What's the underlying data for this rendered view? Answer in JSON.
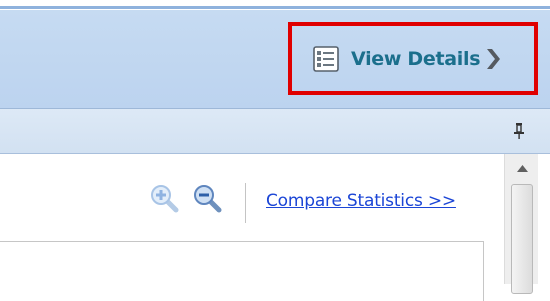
{
  "header": {
    "view_details_label": "View Details",
    "icons": {
      "details": "details-list-icon",
      "chevron": "chevron-right-icon"
    },
    "highlight_color": "#e00000"
  },
  "panel": {
    "icons": {
      "pin": "pin-icon"
    }
  },
  "toolbar": {
    "compare_link_label": "Compare Statistics >>",
    "icons": {
      "zoom_in": "zoom-in-icon",
      "zoom_out": "zoom-out-icon"
    }
  },
  "colors": {
    "header_bg": "#c6dbf2",
    "label_teal": "#1b6f8c",
    "link_blue": "#1b45d6"
  }
}
